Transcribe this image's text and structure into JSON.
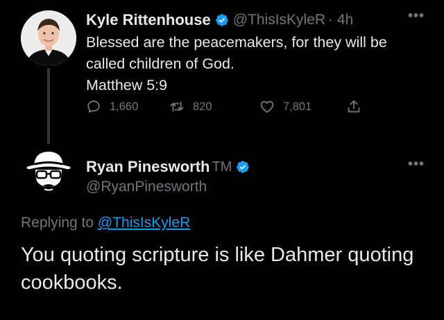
{
  "tweet": {
    "author_name": "Kyle Rittenhouse",
    "handle": "@ThisIsKyleR",
    "time": "· 4h",
    "more": "•••",
    "text": "Blessed are the peacemakers, for they will be\ncalled children of God.\nMatthew 5:9",
    "stats": {
      "replies": "1,660",
      "retweets": "820",
      "likes": "7,801"
    }
  },
  "reply": {
    "author_name": "Ryan Pinesworth",
    "tm": "TM",
    "handle": "@RyanPinesworth",
    "more": "•••",
    "replying_prefix": "Replying to ",
    "replying_to": "@ThisIsKyleR",
    "text": "You quoting scripture is like Dahmer quoting cookbooks."
  },
  "colors": {
    "background": "#000000",
    "text": "#e7e9ea",
    "muted": "#71767b",
    "accent": "#1d9bf0"
  },
  "icons": [
    "verified-badge-icon",
    "more-icon",
    "reply-icon",
    "retweet-icon",
    "like-icon",
    "share-icon"
  ]
}
